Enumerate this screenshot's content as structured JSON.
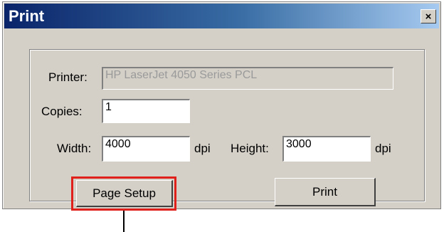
{
  "window": {
    "title": "Print",
    "close_label": "×"
  },
  "form": {
    "printer_label": "Printer:",
    "printer_value": "HP LaserJet 4050 Series PCL",
    "copies_label": "Copies:",
    "copies_value": "1",
    "width_label": "Width:",
    "width_value": "4000",
    "width_unit": "dpi",
    "height_label": "Height:",
    "height_value": "3000",
    "height_unit": "dpi"
  },
  "buttons": {
    "page_setup_label": "Page Setup",
    "print_label": "Print"
  },
  "colors": {
    "dialog_bg": "#d4d0c8",
    "title_bar_start": "#0a246a",
    "title_bar_end": "#a6caf0",
    "highlight": "#e0201a"
  }
}
